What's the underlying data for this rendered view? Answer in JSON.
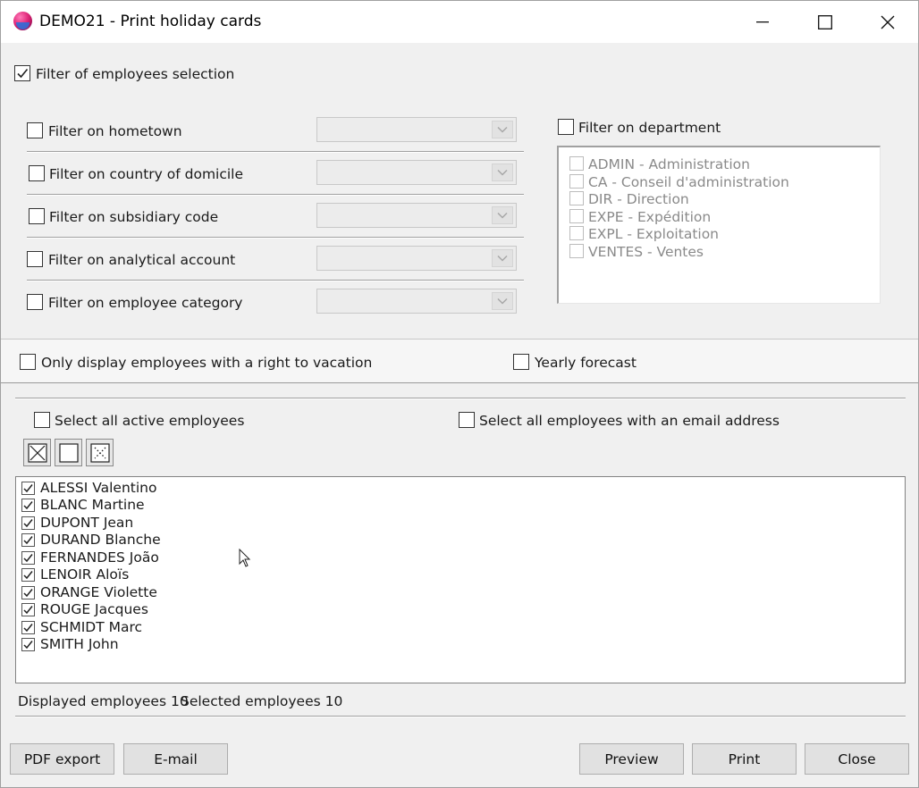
{
  "window": {
    "title": "DEMO21 - Print holiday cards"
  },
  "filters": {
    "main_label": "Filter of employees selection",
    "main_checked": true,
    "rows": [
      {
        "label": "Filter on hometown",
        "checked": false,
        "value": ""
      },
      {
        "label": "Filter on country of domicile",
        "checked": false,
        "value": ""
      },
      {
        "label": "Filter on subsidiary code",
        "checked": false,
        "value": ""
      },
      {
        "label": "Filter on analytical account",
        "checked": false,
        "value": ""
      },
      {
        "label": "Filter on employee category",
        "checked": false,
        "value": ""
      }
    ],
    "department": {
      "label": "Filter on department",
      "checked": false,
      "items": [
        "ADMIN - Administration",
        "CA - Conseil d'administration",
        "DIR - Direction",
        "EXPE - Expédition",
        "EXPL - Exploitation",
        "VENTES - Ventes"
      ]
    }
  },
  "options": {
    "vacation_label": "Only display employees with a right to vacation",
    "forecast_label": "Yearly forecast"
  },
  "selection": {
    "active_label": "Select all active employees",
    "email_label": "Select all employees with an email address"
  },
  "employees": [
    {
      "name": "ALESSI Valentino",
      "checked": true
    },
    {
      "name": "BLANC Martine",
      "checked": true
    },
    {
      "name": "DUPONT Jean",
      "checked": true
    },
    {
      "name": "DURAND Blanche",
      "checked": true
    },
    {
      "name": "FERNANDES João",
      "checked": true
    },
    {
      "name": "LENOIR Aloïs",
      "checked": true
    },
    {
      "name": "ORANGE Violette",
      "checked": true
    },
    {
      "name": "ROUGE Jacques",
      "checked": true
    },
    {
      "name": "SCHMIDT Marc",
      "checked": true
    },
    {
      "name": "SMITH John",
      "checked": true
    }
  ],
  "status": {
    "displayed_label": "Displayed employees",
    "displayed_count": "10",
    "selected_label": "Selected employees",
    "selected_count": "10"
  },
  "buttons": {
    "pdf": "PDF export",
    "email": "E-mail",
    "preview": "Preview",
    "print": "Print",
    "close": "Close"
  },
  "icons": {
    "app": "app-logo-icon",
    "minimize": "minimize-icon",
    "maximize": "maximize-icon",
    "close": "close-icon",
    "check_all": "check-all-icon",
    "uncheck_all": "uncheck-all-icon",
    "invert": "invert-selection-icon"
  }
}
